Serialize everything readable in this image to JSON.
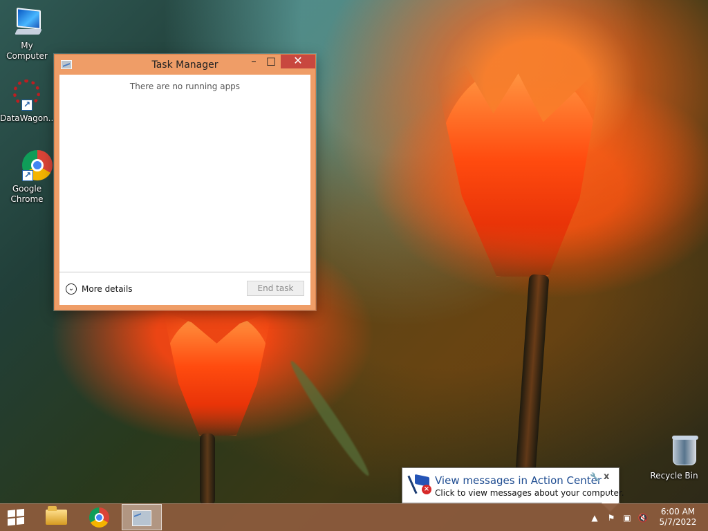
{
  "desktop": {
    "icons": [
      {
        "label": "My Computer",
        "icon": "computer-icon"
      },
      {
        "label": "DataWagon...",
        "icon": "datawagon-icon"
      },
      {
        "label": "Google Chrome",
        "icon": "google-chrome-icon"
      },
      {
        "label": "Recycle Bin",
        "icon": "recycle-bin-icon"
      }
    ],
    "shortcut_symbol": "↗"
  },
  "task_manager": {
    "title": "Task Manager",
    "icon": "task-manager-icon",
    "window_controls": {
      "minimize": "–",
      "maximize": "□",
      "close": "✕"
    },
    "empty_message": "There are no running apps",
    "more_details_label": "More details",
    "more_details_icon": "chevron-down-icon",
    "end_task_label": "End task",
    "end_task_enabled": false,
    "chrome_color": "#ef9d67",
    "close_color": "#c8473f"
  },
  "notification": {
    "title": "View messages in Action Center",
    "message": "Click to view messages about your computer.",
    "icon": "action-center-flag-error-icon",
    "settings_icon": "wrench-icon",
    "close_label": "x"
  },
  "taskbar": {
    "start_icon": "windows-logo-icon",
    "pinned_apps": [
      {
        "name": "File Explorer",
        "icon": "folder-icon"
      },
      {
        "name": "Google Chrome",
        "icon": "chrome-icon"
      },
      {
        "name": "Task Manager",
        "icon": "task-manager-icon",
        "active": true
      }
    ],
    "tray": {
      "show_hidden_icon": "up-arrow-icon",
      "show_hidden_glyph": "▲",
      "action_center_icon": "action-center-flag-error-icon",
      "action_center_glyph": "⚑",
      "network_icon": "network-disconnected-icon",
      "network_glyph": "▣",
      "volume_icon": "volume-muted-icon",
      "volume_glyph": "🔇"
    },
    "time": "6:00 AM",
    "date": "5/7/2022",
    "background_color": "#8b5b3c"
  }
}
